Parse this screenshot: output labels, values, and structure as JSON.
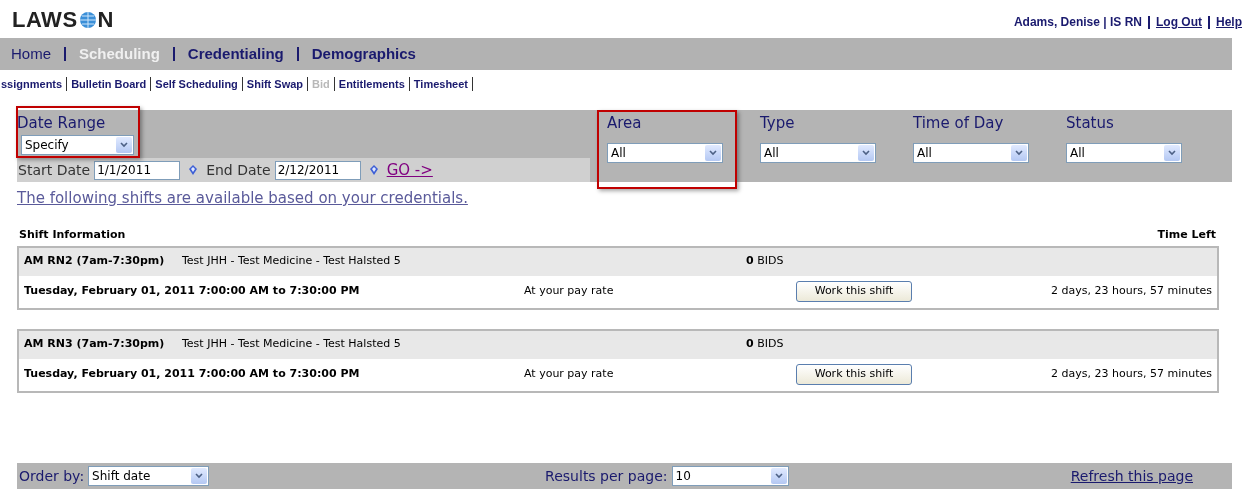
{
  "header": {
    "logo": "LAWS",
    "logo_end": "N",
    "user": "Adams, Denise | IS RN",
    "links": [
      "Log Out",
      "Help"
    ]
  },
  "nav": [
    {
      "label": "Home",
      "selected": false
    },
    {
      "label": "Scheduling",
      "selected": true
    },
    {
      "label": "Credentialing",
      "selected": false
    },
    {
      "label": "Demographics",
      "selected": false
    }
  ],
  "subnav": [
    {
      "label": "ssignments",
      "disabled": false
    },
    {
      "label": "Bulletin Board",
      "disabled": false
    },
    {
      "label": "Self Scheduling",
      "disabled": false
    },
    {
      "label": "Shift Swap",
      "disabled": false
    },
    {
      "label": "Bid",
      "disabled": true
    },
    {
      "label": "Entitlements",
      "disabled": false
    },
    {
      "label": "Timesheet",
      "disabled": false
    }
  ],
  "date_range": {
    "label": "Date Range",
    "value": "Specify",
    "highlighted": true,
    "start_label": "Start Date",
    "start": "1/1/2011",
    "end_label": "End Date",
    "end": "2/12/2011",
    "go": "GO ->"
  },
  "filters": [
    {
      "label": "Area",
      "value": "All",
      "highlighted": true
    },
    {
      "label": "Type",
      "value": "All",
      "highlighted": false
    },
    {
      "label": "Time of Day",
      "value": "All",
      "highlighted": false
    },
    {
      "label": "Status",
      "value": "All",
      "highlighted": false
    }
  ],
  "credentials_link": "The following shifts are available based on your credentials.",
  "columns": [
    "Shift Information",
    "Time Left"
  ],
  "shifts": [
    {
      "name": "AM RN2 (7am-7:30pm)",
      "location": "Test JHH - Test Medicine - Test Halsted 5",
      "bids": "0",
      "bids_label": "BIDS",
      "date": "Tuesday, February 01, 2011 7:00:00 AM to 7:30:00 PM",
      "rate": "At your pay rate",
      "button": "Work this shift",
      "time_left": "2 days, 23 hours, 57 minutes"
    },
    {
      "name": "AM RN3 (7am-7:30pm)",
      "location": "Test JHH - Test Medicine - Test Halsted 5",
      "bids": "0",
      "bids_label": "BIDS",
      "date": "Tuesday, February 01, 2011 7:00:00 AM to 7:30:00 PM",
      "rate": "At your pay rate",
      "button": "Work this shift",
      "time_left": "2 days, 23 hours, 57 minutes"
    }
  ],
  "footer": {
    "order_label": "Order by:",
    "order_value": "Shift date",
    "results_label": "Results per page:",
    "results_value": "10",
    "refresh": "Refresh this page"
  }
}
